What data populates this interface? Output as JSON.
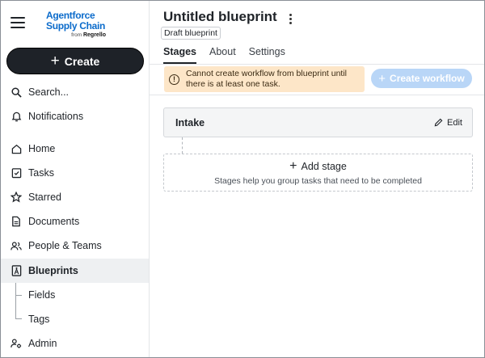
{
  "sidebar": {
    "logo": {
      "line1": "Agentforce",
      "line2": "Supply Chain",
      "line3_prefix": "from",
      "line3_brand": "Regrello"
    },
    "create_label": "Create",
    "search_label": "Search...",
    "notifications_label": "Notifications",
    "items": [
      {
        "label": "Home",
        "icon": "home-icon"
      },
      {
        "label": "Tasks",
        "icon": "task-check-icon"
      },
      {
        "label": "Starred",
        "icon": "star-icon"
      },
      {
        "label": "Documents",
        "icon": "document-icon"
      },
      {
        "label": "People & Teams",
        "icon": "people-icon"
      },
      {
        "label": "Blueprints",
        "icon": "blueprint-icon",
        "active": true
      },
      {
        "label": "Fields",
        "icon": ""
      },
      {
        "label": "Tags",
        "icon": ""
      },
      {
        "label": "Admin",
        "icon": "admin-icon"
      }
    ]
  },
  "header": {
    "title": "Untitled blueprint",
    "badge": "Draft blueprint",
    "tabs": [
      {
        "label": "Stages",
        "active": true
      },
      {
        "label": "About",
        "active": false
      },
      {
        "label": "Settings",
        "active": false
      }
    ]
  },
  "warning": {
    "text": "Cannot create workflow from blueprint until there is at least one task."
  },
  "create_workflow_label": "Create workflow",
  "stages": [
    {
      "name": "Intake",
      "edit_label": "Edit"
    }
  ],
  "add_stage": {
    "label": "Add stage",
    "hint": "Stages help you group tasks that need to be completed"
  },
  "colors": {
    "accent": "#0b6bcb",
    "create_button_bg": "#1e2228",
    "warning_bg": "#fde6c8",
    "disabled_button_bg": "#b9d6f7"
  }
}
